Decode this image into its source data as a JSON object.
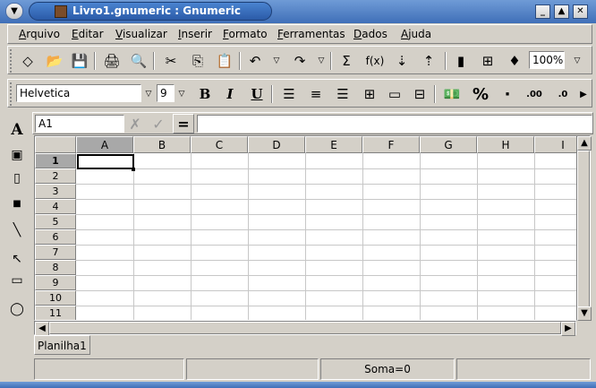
{
  "window": {
    "title": "Livro1.gnumeric : Gnumeric"
  },
  "menu": [
    "Arquivo",
    "Editar",
    "Visualizar",
    "Inserir",
    "Formato",
    "Ferramentas",
    "Dados",
    "Ajuda"
  ],
  "format_toolbar": {
    "font_name": "Helvetica",
    "font_size": "9",
    "bold": "B",
    "italic": "I",
    "underline": "U",
    "percent": "%",
    "thousands": "·",
    "inc_decimals": ".00",
    "dec_decimals": ".0"
  },
  "standard_toolbar": {
    "zoom": "100%"
  },
  "edit_line": {
    "cell_ref": "A1",
    "equals": "="
  },
  "columns": [
    "A",
    "B",
    "C",
    "D",
    "E",
    "F",
    "G",
    "H",
    "I"
  ],
  "rows": [
    "1",
    "2",
    "3",
    "4",
    "5",
    "6",
    "7",
    "8",
    "9",
    "10",
    "11"
  ],
  "sheet_tab": "Planilha1",
  "status": {
    "sum": "Soma=0"
  }
}
